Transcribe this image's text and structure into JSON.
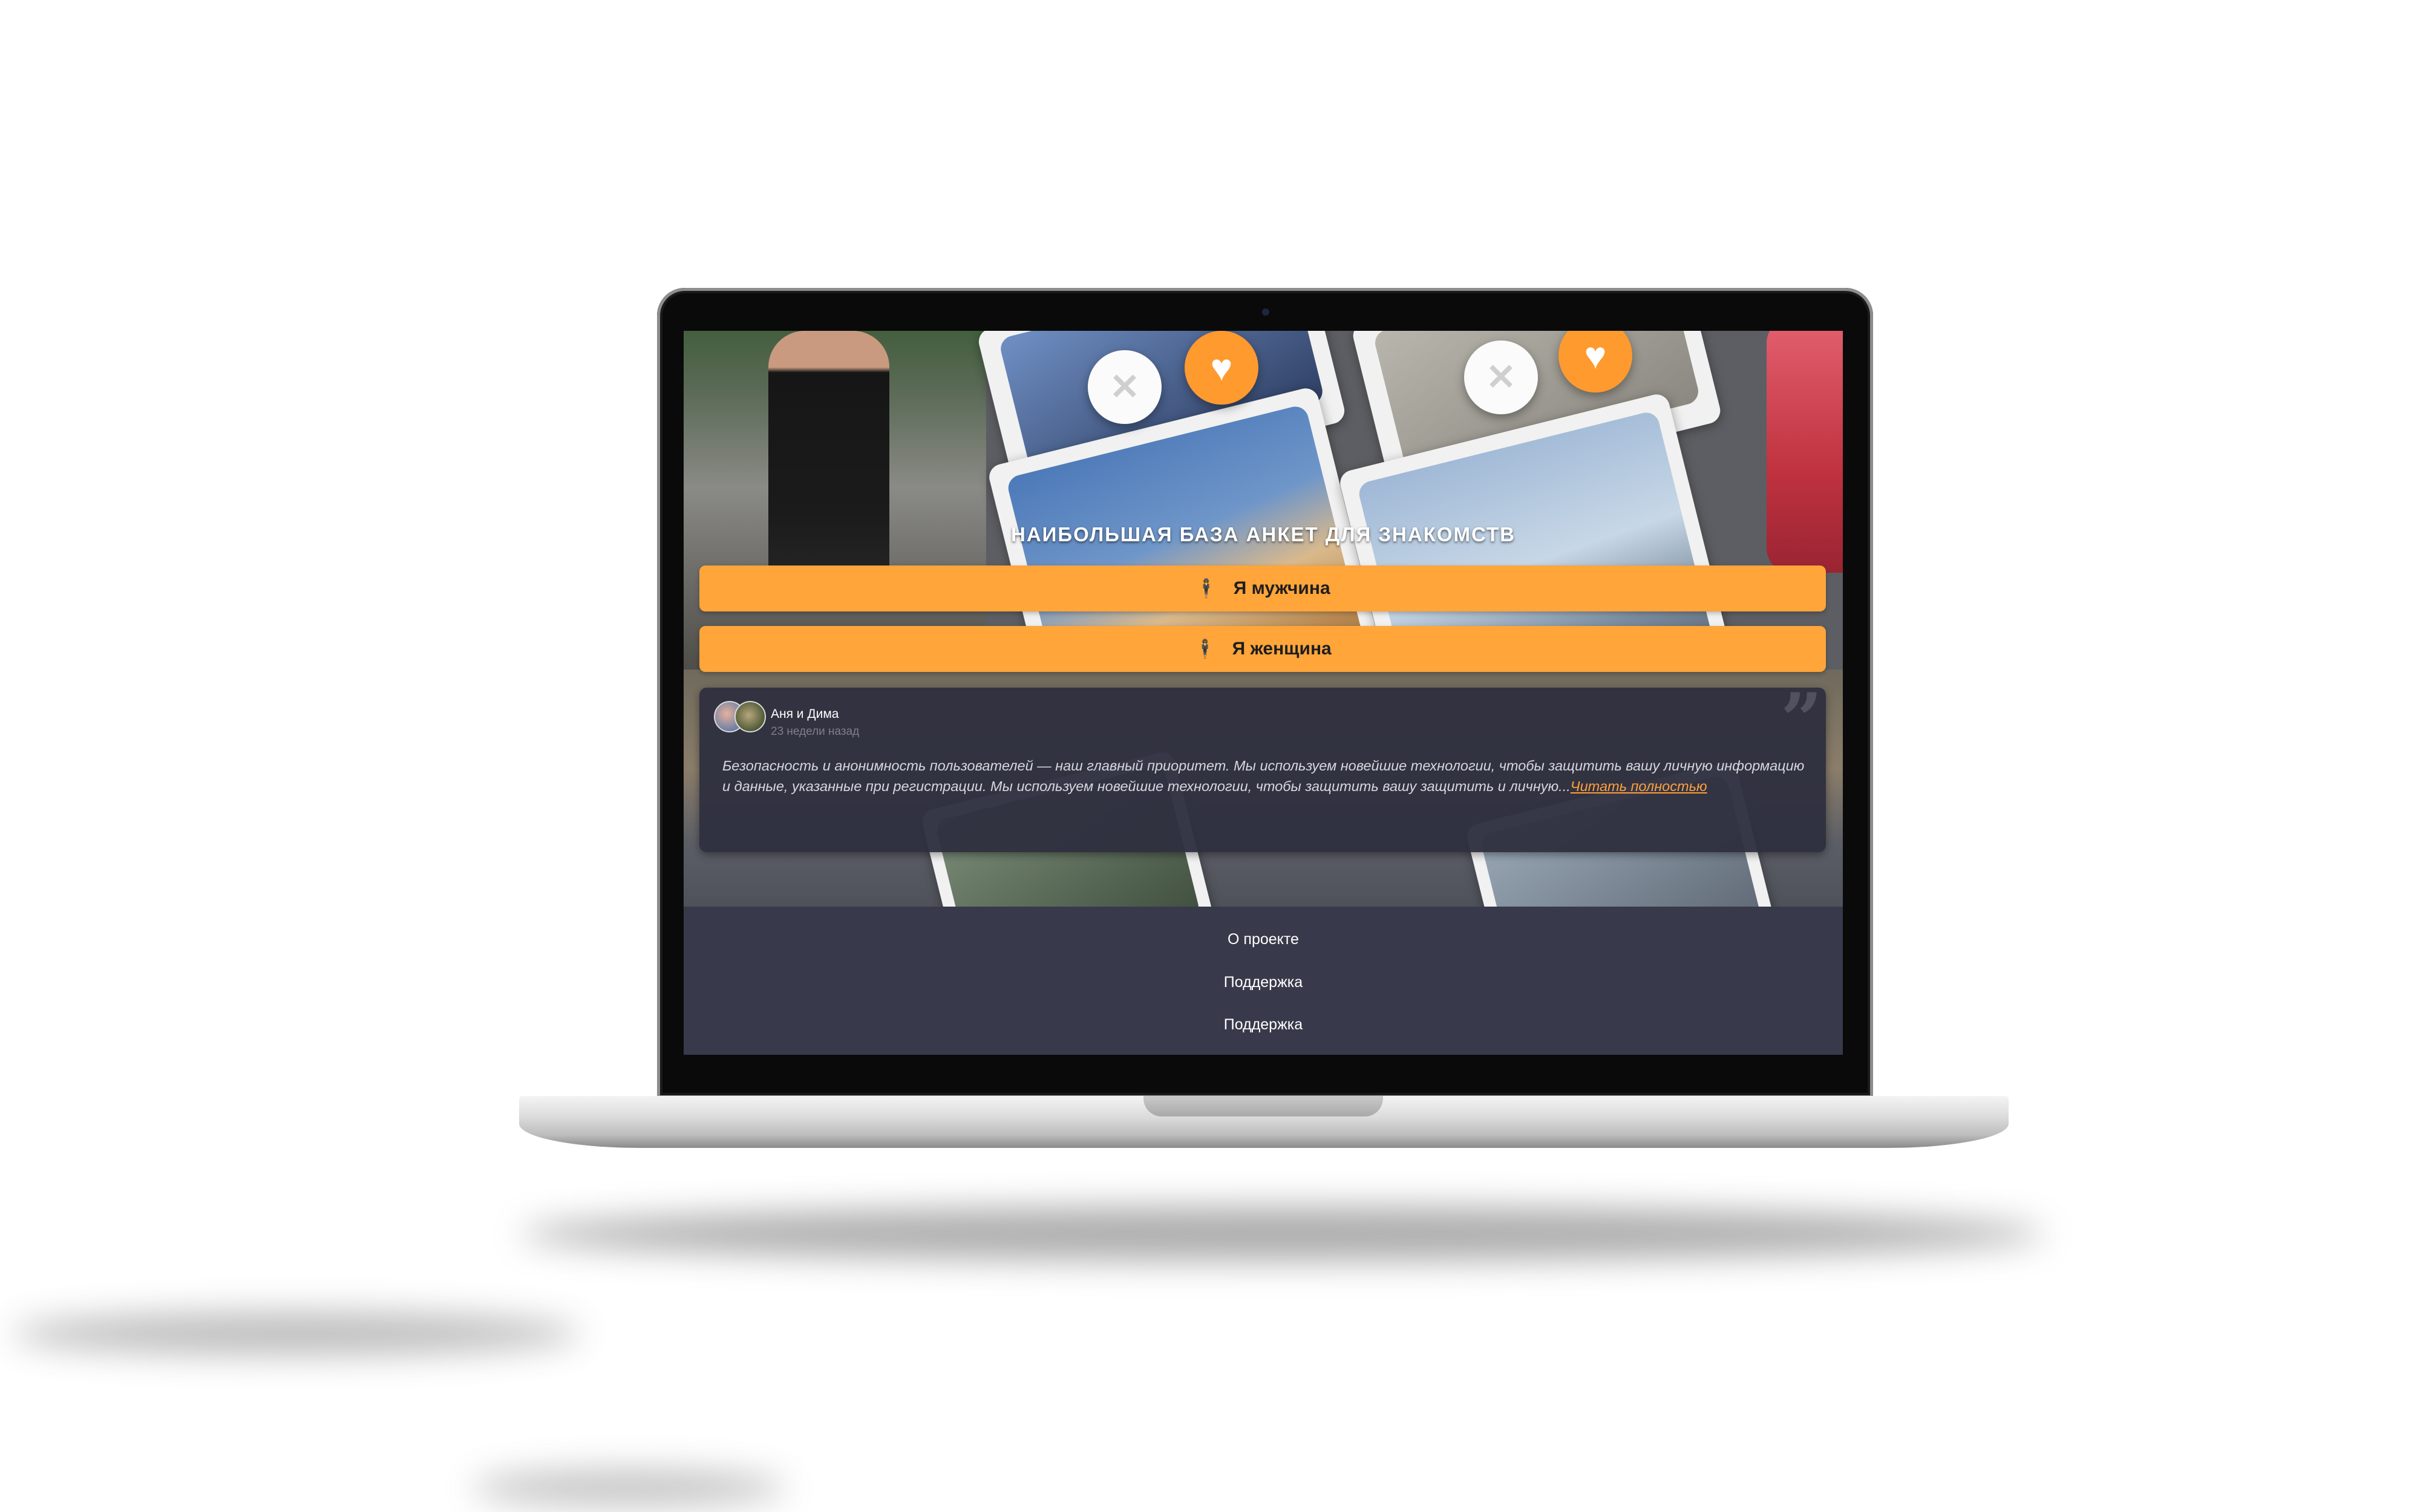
{
  "hero": {
    "title": "НАИБОЛЬШАЯ БАЗА АНКЕТ ДЛЯ ЗНАКОМСТВ",
    "buttons": [
      {
        "label": "Я мужчина",
        "icon": "person-icon"
      },
      {
        "label": "Я женщина",
        "icon": "person-icon"
      }
    ],
    "swipe_icons": {
      "dislike": "close-icon",
      "like": "heart-icon"
    }
  },
  "review": {
    "author": "Аня и Дима",
    "time": "23 недели назад",
    "text": "Безопасность и анонимность пользователей — наш главный приоритет. Мы используем новейшие технологии, чтобы защитить вашу личную информацию и данные, указанные при регистрации. Мы используем новейшие технологии, чтобы защитить вашу защитить и личную...",
    "read_more": "Читать полностью"
  },
  "footer": {
    "links": [
      "О проекте",
      "Поддержка",
      "Поддержка"
    ]
  },
  "colors": {
    "accent": "#ffa53a",
    "footer_bg": "#383a4b",
    "review_bg": "#2f3040"
  }
}
